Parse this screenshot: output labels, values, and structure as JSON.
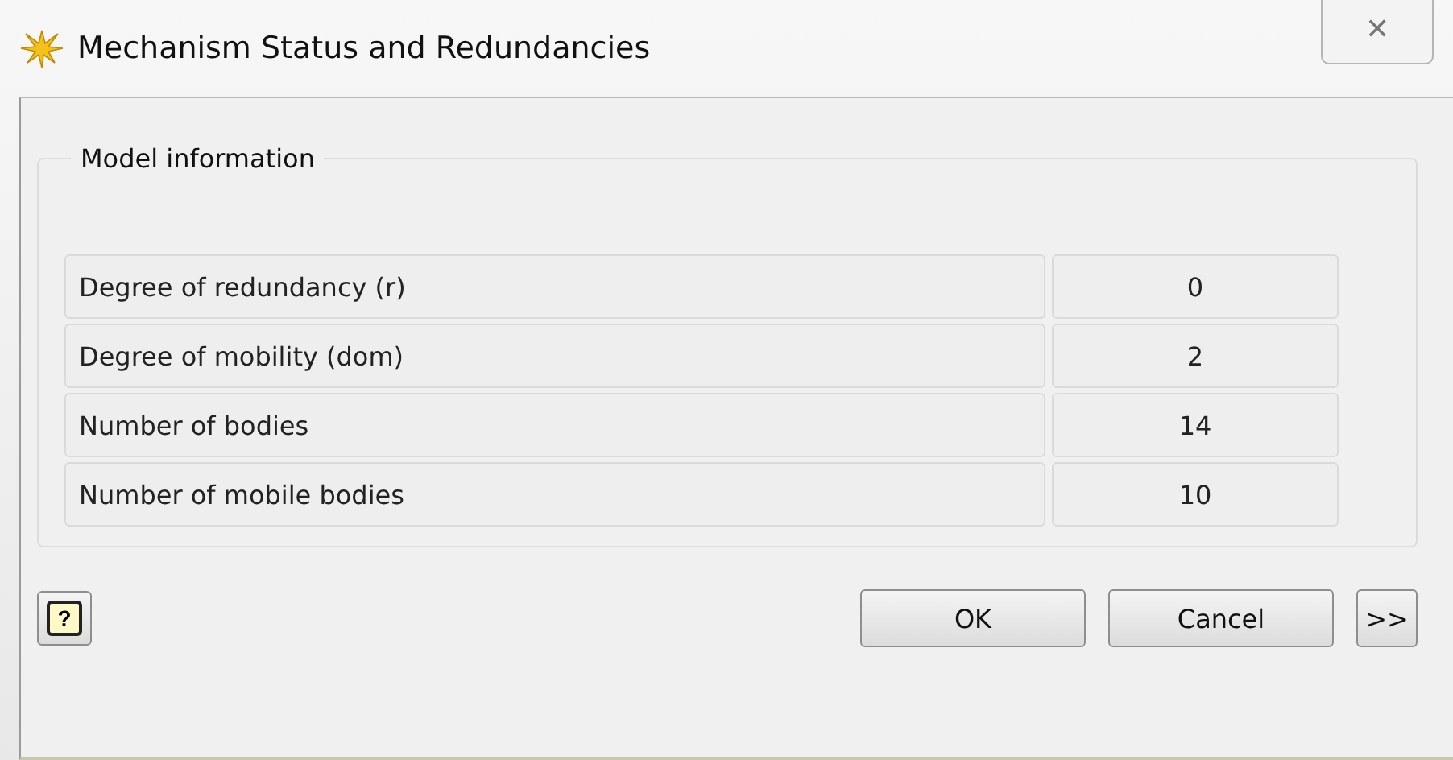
{
  "window": {
    "title": "Mechanism Status and Redundancies",
    "close_glyph": "✕"
  },
  "group": {
    "title": "Model information",
    "rows": [
      {
        "label": "Degree of redundancy (r)",
        "value": "0"
      },
      {
        "label": "Degree of mobility (dom)",
        "value": "2"
      },
      {
        "label": "Number of bodies",
        "value": "14"
      },
      {
        "label": "Number of mobile bodies",
        "value": "10"
      }
    ]
  },
  "buttons": {
    "help": "?",
    "ok": "OK",
    "cancel": "Cancel",
    "more": ">>"
  }
}
